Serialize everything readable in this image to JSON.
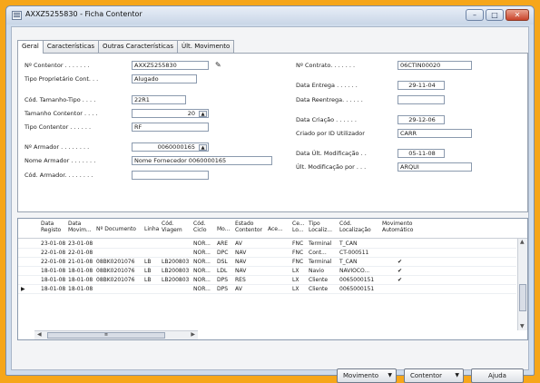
{
  "window": {
    "title": "AXXZ5255830 - Ficha Contentor",
    "buttons": {
      "minimize": "–",
      "maximize": "□",
      "close": "✕"
    }
  },
  "tabs": [
    "Geral",
    "Características",
    "Outras Características",
    "Últ. Movimento"
  ],
  "form": {
    "left": [
      {
        "label": "Nº Contentor . . . . . . .",
        "value": "AXXZ5255830"
      },
      {
        "label": "Tipo Proprietário Cont. . .",
        "value": "Alugado"
      },
      {
        "label": "Cód. Tamanho-Tipo . . . .",
        "value": "22R1"
      },
      {
        "label": "Tamanho Contentor . . . .",
        "value": "20"
      },
      {
        "label": "Tipo Contentor . . . . . .",
        "value": "RF"
      },
      {
        "label": "Nº Armador . . . . . . . .",
        "value": "0060000165"
      },
      {
        "label": "Nome Armador . . . . . . .",
        "value": "Nome Fornecedor 0060000165"
      },
      {
        "label": "Cód. Armador. . . . . . . .",
        "value": ""
      }
    ],
    "right": [
      {
        "label": "Nº Contrato. . . . . . .",
        "value": "06CTIN00020"
      },
      {
        "label": "Data Entrega . . . . . .",
        "value": "29-11-04"
      },
      {
        "label": "Data Reentrega. . . . . .",
        "value": ""
      },
      {
        "label": "Data Criação . . . . . .",
        "value": "29-12-06"
      },
      {
        "label": "Criado por ID Utilizador",
        "value": "CARR"
      },
      {
        "label": "Data Últ. Modificação . .",
        "value": "05-11-08"
      },
      {
        "label": "Últ. Modificação por . . .",
        "value": "ARQUI"
      }
    ]
  },
  "grid": {
    "headers": [
      "Data\nRegisto",
      "Data\nMovim...",
      "Nº Documento",
      "Linha",
      "Cód.\nViagem",
      "Cód.\nCiclo",
      "Mo...",
      "Estado\nContentor",
      "Ace...",
      "Ce...\nLo...",
      "Tipo\nLocaliz...",
      "Cód.\nLocalização",
      "Movimento\nAutomático"
    ],
    "rows": [
      [
        "23-01-08",
        "23-01-08",
        "",
        "",
        "",
        "NOR...",
        "ARE",
        "AV",
        "",
        "FNC",
        "Terminal",
        "T_CAN",
        ""
      ],
      [
        "22-01-08",
        "22-01-08",
        "",
        "",
        "",
        "NOR...",
        "DPC",
        "NAV",
        "",
        "FNC",
        "Cont...",
        "CT-000511",
        ""
      ],
      [
        "22-01-08",
        "21-01-08",
        "08BK0201076",
        "LB",
        "LB200803",
        "NOR...",
        "DSL",
        "NAV",
        "",
        "FNC",
        "Terminal",
        "T_CAN",
        "✔"
      ],
      [
        "18-01-08",
        "18-01-08",
        "08BK0201076",
        "LB",
        "LB200803",
        "NOR...",
        "LDL",
        "NAV",
        "",
        "LX",
        "Navio",
        "NAVIOCO...",
        "✔"
      ],
      [
        "18-01-08",
        "18-01-08",
        "08BK0201076",
        "LB",
        "LB200803",
        "NOR...",
        "DPS",
        "RES",
        "",
        "LX",
        "Cliente",
        "0065000151",
        "✔"
      ],
      [
        "18-01-08",
        "18-01-08",
        "",
        "",
        "",
        "NOR...",
        "DPS",
        "AV",
        "",
        "LX",
        "Cliente",
        "0065000151",
        ""
      ]
    ],
    "selected_row": 5,
    "row_marker": "▶"
  },
  "buttons": {
    "movimento": "Movimento",
    "contentor": "Contentor",
    "ajuda": "Ajuda"
  },
  "colors": {
    "outer_frame": "#f6a61a",
    "window_bg": "#cfdcec",
    "close_btn": "#c8432a"
  }
}
